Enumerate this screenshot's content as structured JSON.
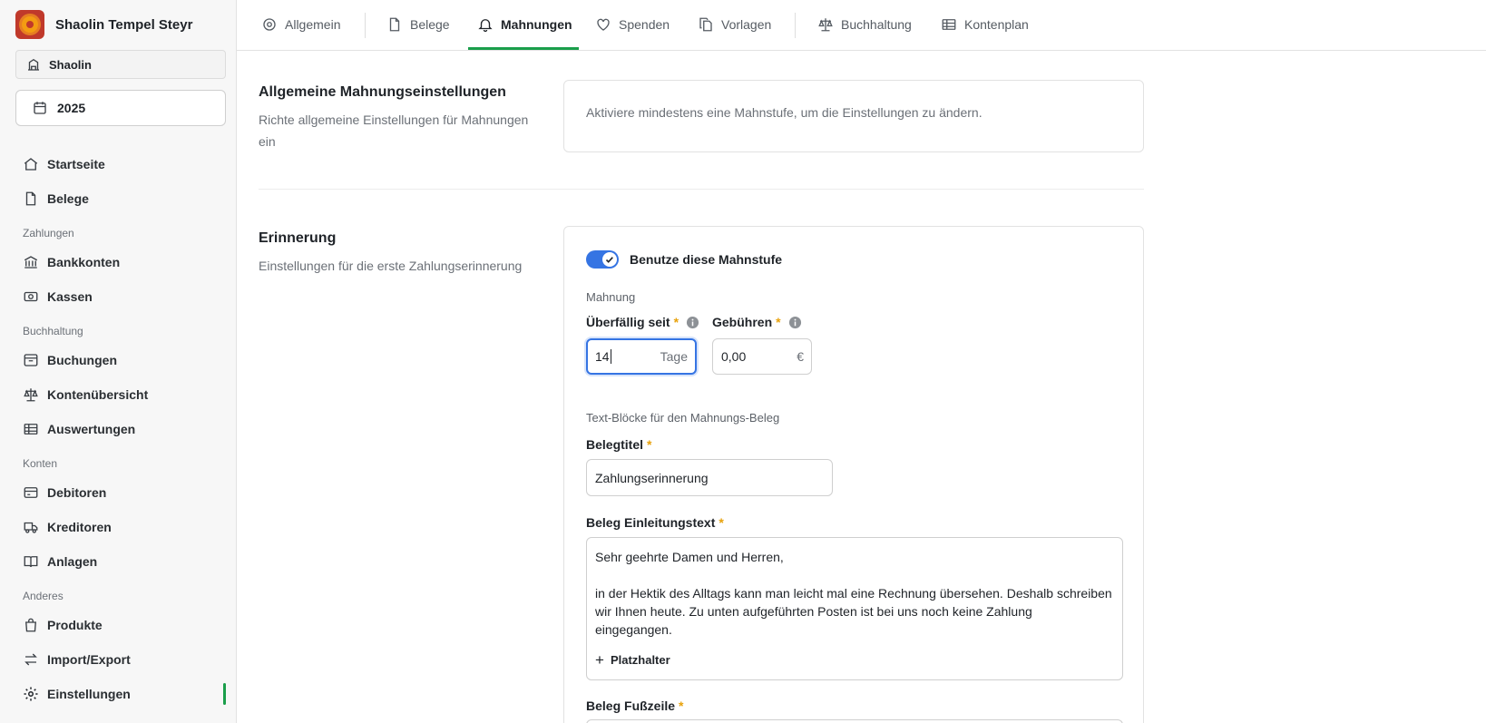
{
  "sidebar": {
    "org_name": "Shaolin Tempel Steyr",
    "workspace_label": "Shaolin",
    "year_label": "2025",
    "items": {
      "startseite": "Startseite",
      "belege": "Belege",
      "group_zahlungen": "Zahlungen",
      "bankkonten": "Bankkonten",
      "kassen": "Kassen",
      "group_buchhaltung": "Buchhaltung",
      "buchungen": "Buchungen",
      "kontenuebersicht": "Kontenübersicht",
      "auswertungen": "Auswertungen",
      "group_konten": "Konten",
      "debitoren": "Debitoren",
      "kreditoren": "Kreditoren",
      "anlagen": "Anlagen",
      "group_anderes": "Anderes",
      "produkte": "Produkte",
      "import_export": "Import/Export",
      "einstellungen": "Einstellungen"
    }
  },
  "tabs": {
    "allgemein": "Allgemein",
    "belege": "Belege",
    "mahnungen": "Mahnungen",
    "spenden": "Spenden",
    "vorlagen": "Vorlagen",
    "buchhaltung": "Buchhaltung",
    "kontenplan": "Kontenplan"
  },
  "general_settings": {
    "title": "Allgemeine Mahnungseinstellungen",
    "description": "Richte allgemeine Einstellungen für Mahnungen ein",
    "message": "Aktiviere mindestens eine Mahnstufe, um die Einstellungen zu ändern."
  },
  "reminder": {
    "title": "Erinnerung",
    "description": "Einstellungen für die erste Zahlungserinnerung",
    "toggle_label": "Benutze diese Mahnstufe",
    "mahnung_heading": "Mahnung",
    "overdue_label": "Überfällig seit",
    "overdue_value": "14",
    "overdue_unit": "Tage",
    "fees_label": "Gebühren",
    "fees_value": "0,00",
    "fees_unit": "€",
    "required_mark": "*",
    "textblocks_heading": "Text-Blöcke für den Mahnungs-Beleg",
    "doc_title_label": "Belegtitel",
    "doc_title_value": "Zahlungserinnerung",
    "intro_label": "Beleg Einleitungstext",
    "intro_line1": "Sehr geehrte Damen und Herren,",
    "intro_line2": "in der Hektik des Alltags kann man leicht mal eine Rechnung übersehen. Deshalb schreiben wir Ihnen heute. Zu unten aufgeführten Posten ist bei uns noch keine Zahlung eingegangen.",
    "placeholder_button": "Platzhalter",
    "footer_label": "Beleg Fußzeile"
  }
}
